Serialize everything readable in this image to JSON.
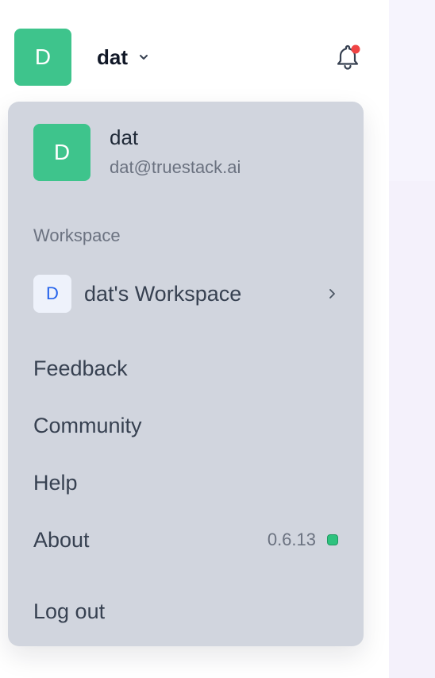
{
  "colors": {
    "avatar_bg": "#3ec48c",
    "menu_bg": "#d1d5de",
    "notification_dot": "#ef4444",
    "status_dot": "#2ec27e",
    "workspace_badge_text": "#2563eb"
  },
  "topbar": {
    "avatar_initial": "D",
    "user_name": "dat",
    "chevron_icon": "chevron-down-icon",
    "bell_icon": "bell-icon",
    "has_notification": true
  },
  "menu": {
    "user": {
      "avatar_initial": "D",
      "name": "dat",
      "email": "dat@truestack.ai"
    },
    "workspace_section_label": "Workspace",
    "workspace": {
      "badge_initial": "D",
      "name": "dat's Workspace",
      "chevron_icon": "chevron-right-icon"
    },
    "items": {
      "feedback": "Feedback",
      "community": "Community",
      "help": "Help",
      "about": "About",
      "logout": "Log out"
    },
    "version": "0.6.13",
    "status": "online"
  }
}
